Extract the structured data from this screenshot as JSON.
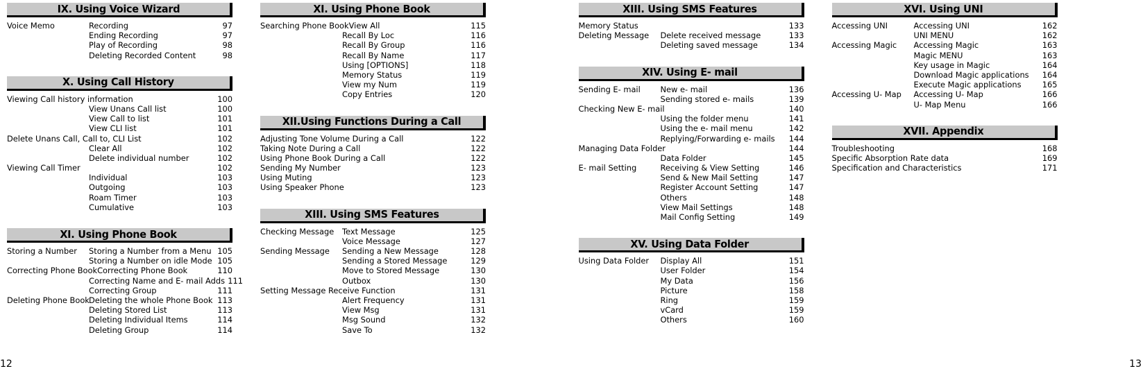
{
  "document": {
    "left_folio": "12",
    "right_folio": "13"
  },
  "sections": [
    {
      "id": "voice-wizard",
      "title": "IX. Using Voice Wizard",
      "column": 0,
      "entries": [
        {
          "label": "Voice Memo",
          "mid": "Recording",
          "page": "97"
        },
        {
          "label": "",
          "mid": "Ending Recording",
          "page": "97"
        },
        {
          "label": "",
          "mid": "Play of Recording",
          "page": "98"
        },
        {
          "label": "",
          "mid": "Deleting Recorded Content",
          "page": "98"
        }
      ]
    },
    {
      "id": "call-history",
      "title": "X. Using Call History",
      "column": 0,
      "entries": [
        {
          "label": "Viewing Call history information",
          "mid": "",
          "page": "100",
          "bleed": true
        },
        {
          "label": "",
          "mid": "View Unans Call list",
          "page": "100"
        },
        {
          "label": "",
          "mid": "View Call to list",
          "page": "101"
        },
        {
          "label": "",
          "mid": "View CLI list",
          "page": "101"
        },
        {
          "label": "Delete Unans Call, Call to, CLI List",
          "mid": "",
          "page": "102",
          "bleed": true
        },
        {
          "label": "",
          "mid": "Clear All",
          "page": "102"
        },
        {
          "label": "",
          "mid": "Delete individual number",
          "page": "102"
        },
        {
          "label": "Viewing Call Timer",
          "mid": "",
          "page": "102"
        },
        {
          "label": "",
          "mid": "Individual",
          "page": "103"
        },
        {
          "label": "",
          "mid": "Outgoing",
          "page": "103"
        },
        {
          "label": "",
          "mid": "Roam Timer",
          "page": "103"
        },
        {
          "label": "",
          "mid": "Cumulative",
          "page": "103"
        }
      ]
    },
    {
      "id": "phone-book-left",
      "title": "XI. Using Phone Book",
      "column": 0,
      "entries": [
        {
          "label": "Storing a Number",
          "mid": "Storing a Number from a Menu",
          "page": "105"
        },
        {
          "label": "",
          "mid": "Storing a Number on idle Mode",
          "page": "105"
        },
        {
          "label": "Correcting Phone Book",
          "mid": "Correcting Phone Book",
          "page": "110",
          "bleed": true
        },
        {
          "label": "",
          "mid": "Correcting Name and E- mail Adds",
          "page": "111"
        },
        {
          "label": "",
          "mid": "Correcting Group",
          "page": "111"
        },
        {
          "label": "Deleting Phone Book",
          "mid": "Deleting the whole Phone Book",
          "page": "113"
        },
        {
          "label": "",
          "mid": "Deleting Stored List",
          "page": "113"
        },
        {
          "label": "",
          "mid": "Deleting Individual Items",
          "page": "114"
        },
        {
          "label": "",
          "mid": "Deleting Group",
          "page": "114"
        }
      ]
    },
    {
      "id": "phone-book-right",
      "title": "XI. Using Phone Book",
      "column": 1,
      "entries": [
        {
          "label": "Searching Phone Book",
          "mid": "View All",
          "page": "115",
          "bleed": true
        },
        {
          "label": "",
          "mid": "Recall By Loc",
          "page": "116"
        },
        {
          "label": "",
          "mid": "Recall By Group",
          "page": "116"
        },
        {
          "label": "",
          "mid": "Recall By Name",
          "page": "117"
        },
        {
          "label": "",
          "mid": "Using [OPTIONS]",
          "page": "118"
        },
        {
          "label": "",
          "mid": "Memory Status",
          "page": "119"
        },
        {
          "label": "",
          "mid": "View my Num",
          "page": "119"
        },
        {
          "label": "",
          "mid": "Copy Entries",
          "page": "120"
        }
      ]
    },
    {
      "id": "functions-during-call",
      "title": "XII.Using Functions During a Call",
      "column": 1,
      "entries": [
        {
          "label": "Adjusting Tone Volume During a Call",
          "mid": "",
          "page": "122",
          "bleed": true
        },
        {
          "label": "Taking Note During a Call",
          "mid": "",
          "page": "122",
          "bleed": true
        },
        {
          "label": "Using Phone Book During a Call",
          "mid": "",
          "page": "122",
          "bleed": true
        },
        {
          "label": "Sending My Number",
          "mid": "",
          "page": "123",
          "bleed": true
        },
        {
          "label": "Using Muting",
          "mid": "",
          "page": "123",
          "bleed": true
        },
        {
          "label": "Using Speaker Phone",
          "mid": "",
          "page": "123",
          "bleed": true
        }
      ]
    },
    {
      "id": "sms-features-left",
      "title": "XIII. Using SMS Features",
      "column": 1,
      "entries": [
        {
          "label": "Checking Message",
          "mid": "Text Message",
          "page": "125"
        },
        {
          "label": "",
          "mid": "Voice Message",
          "page": "127"
        },
        {
          "label": "Sending Message",
          "mid": "Sending a New Message",
          "page": "128"
        },
        {
          "label": "",
          "mid": "Sending a Stored Message",
          "page": "129"
        },
        {
          "label": "",
          "mid": "Move to Stored Message",
          "page": "130"
        },
        {
          "label": "",
          "mid": "Outbox",
          "page": "130"
        },
        {
          "label": "Setting Message Receive Function",
          "mid": "",
          "page": "131",
          "bleed": true
        },
        {
          "label": "",
          "mid": "Alert Frequency",
          "page": "131"
        },
        {
          "label": "",
          "mid": "View Msg",
          "page": "131"
        },
        {
          "label": "",
          "mid": "Msg Sound",
          "page": "132"
        },
        {
          "label": "",
          "mid": "Save To",
          "page": "132"
        }
      ]
    },
    {
      "id": "sms-features-right",
      "title": "XIII. Using SMS Features",
      "column": 2,
      "entries": [
        {
          "label": "Memory Status",
          "mid": "",
          "page": "133"
        },
        {
          "label": "Deleting Message",
          "mid": "Delete received message",
          "page": "133"
        },
        {
          "label": "",
          "mid": "Deleting saved message",
          "page": "134"
        }
      ]
    },
    {
      "id": "email",
      "title": "XIV. Using E- mail",
      "column": 2,
      "entries": [
        {
          "label": "Sending E- mail",
          "mid": "New e- mail",
          "page": "136"
        },
        {
          "label": "",
          "mid": "Sending stored e- mails",
          "page": "139"
        },
        {
          "label": "Checking New E- mail",
          "mid": "",
          "page": "140"
        },
        {
          "label": "",
          "mid": "Using the folder menu",
          "page": "141"
        },
        {
          "label": "",
          "mid": "Using the e- mail menu",
          "page": "142"
        },
        {
          "label": "",
          "mid": "Replying/Forwarding e- mails",
          "page": "144"
        },
        {
          "label": "Managing Data Folder",
          "mid": "",
          "page": "144"
        },
        {
          "label": "",
          "mid": "Data Folder",
          "page": "145"
        },
        {
          "label": "E- mail Setting",
          "mid": "Receiving & View Setting",
          "page": "146"
        },
        {
          "label": "",
          "mid": "Send & New Mail Setting",
          "page": "147"
        },
        {
          "label": "",
          "mid": "Register Account Setting",
          "page": "147"
        },
        {
          "label": "",
          "mid": "Others",
          "page": "148"
        },
        {
          "label": "",
          "mid": "View Mail Settings",
          "page": "148"
        },
        {
          "label": "",
          "mid": "Mail Config Setting",
          "page": "149"
        }
      ]
    },
    {
      "id": "data-folder",
      "title": "XV. Using Data Folder",
      "column": 2,
      "entries": [
        {
          "label": "Using Data Folder",
          "mid": "Display All",
          "page": "151"
        },
        {
          "label": "",
          "mid": "User Folder",
          "page": "154"
        },
        {
          "label": "",
          "mid": "My Data",
          "page": "156"
        },
        {
          "label": "",
          "mid": "Picture",
          "page": "158"
        },
        {
          "label": "",
          "mid": "Ring",
          "page": "159"
        },
        {
          "label": "",
          "mid": "vCard",
          "page": "159"
        },
        {
          "label": "",
          "mid": "Others",
          "page": "160"
        }
      ]
    },
    {
      "id": "uni",
      "title": "XVI. Using UNI",
      "column": 3,
      "entries": [
        {
          "label": "Accessing UNI",
          "mid": "Accessing UNI",
          "page": "162"
        },
        {
          "label": "",
          "mid": "UNI MENU",
          "page": "162"
        },
        {
          "label": "Accessing Magic",
          "mid": "Accessing Magic",
          "page": "163"
        },
        {
          "label": "",
          "mid": "Magic MENU",
          "page": "163"
        },
        {
          "label": "",
          "mid": "Key usage in Magic",
          "page": "164"
        },
        {
          "label": "",
          "mid": "Download Magic applications",
          "page": "164"
        },
        {
          "label": "",
          "mid": "Execute Magic applications",
          "page": "165"
        },
        {
          "label": "Accessing U- Map",
          "mid": "Accessing U- Map",
          "page": "166"
        },
        {
          "label": "",
          "mid": "U- Map Menu",
          "page": "166"
        }
      ]
    },
    {
      "id": "appendix",
      "title": "XVII. Appendix",
      "column": 3,
      "entries": [
        {
          "label": "Troubleshooting",
          "mid": "",
          "page": "168",
          "bleed": true
        },
        {
          "label": "Specific Absorption Rate data",
          "mid": "",
          "page": "169",
          "bleed": true
        },
        {
          "label": "Specification and Characteristics",
          "mid": "",
          "page": "171",
          "bleed": true
        }
      ]
    }
  ]
}
